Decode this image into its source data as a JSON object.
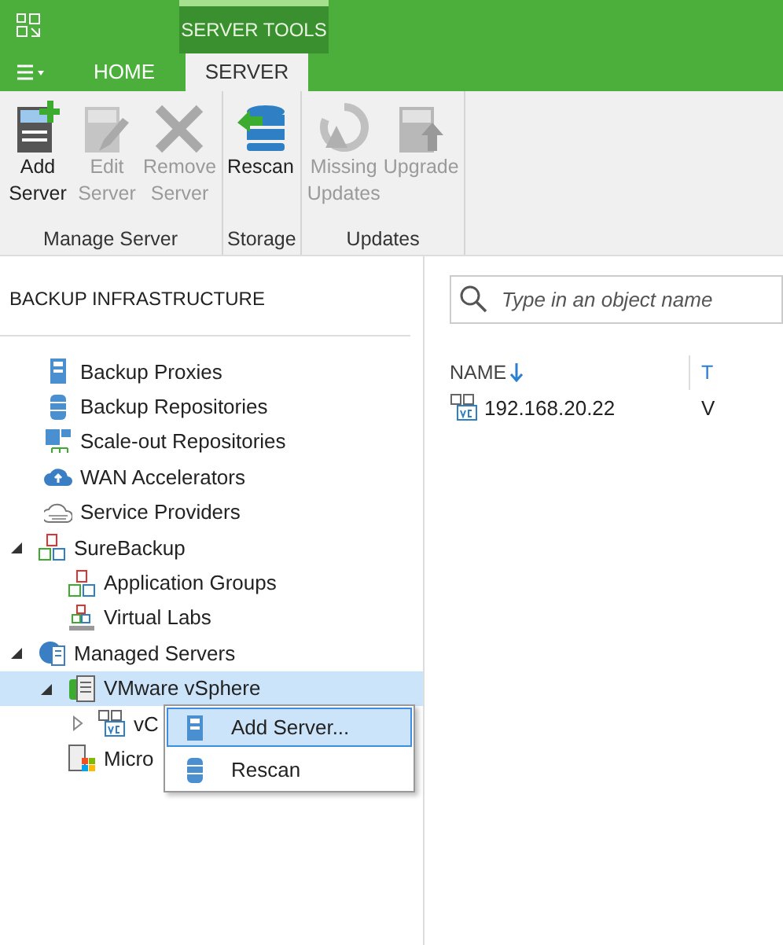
{
  "title_bar": {
    "context_tab": "SERVER TOOLS"
  },
  "tabs": [
    {
      "label": "HOME",
      "selected": false
    },
    {
      "label": "SERVER",
      "selected": true
    }
  ],
  "ribbon": {
    "groups": [
      {
        "label": "Manage Server",
        "buttons": [
          {
            "kind": "add-server",
            "label": "Add Server",
            "disabled": false
          },
          {
            "kind": "edit-server",
            "label": "Edit Server",
            "disabled": true
          },
          {
            "kind": "remove",
            "label": "Remove Server",
            "disabled": true
          }
        ]
      },
      {
        "label": "Storage",
        "buttons": [
          {
            "kind": "rescan",
            "label": "Rescan",
            "disabled": false
          }
        ]
      },
      {
        "label": "Updates",
        "buttons": [
          {
            "kind": "missing-updates",
            "label": "Missing Updates",
            "disabled": true
          },
          {
            "kind": "upgrade",
            "label": "Upgrade",
            "disabled": true
          }
        ]
      }
    ]
  },
  "sidebar": {
    "title": "BACKUP INFRASTRUCTURE",
    "items": [
      {
        "kind": "proxy",
        "label": "Backup Proxies",
        "selected": false
      },
      {
        "kind": "repository",
        "label": "Backup Repositories",
        "selected": false
      },
      {
        "kind": "scaleout",
        "label": "Scale-out Repositories",
        "selected": false
      },
      {
        "kind": "wan",
        "label": "WAN Accelerators",
        "selected": false
      },
      {
        "kind": "provider",
        "label": "Service Providers",
        "selected": false
      },
      {
        "kind": "surebackup",
        "label": "SureBackup",
        "selected": false,
        "expanded": true,
        "children": [
          {
            "kind": "surebackup",
            "label": "Application Groups",
            "selected": false
          },
          {
            "kind": "lab",
            "label": "Virtual Labs",
            "selected": false
          }
        ]
      },
      {
        "kind": "managed",
        "label": "Managed Servers",
        "selected": false,
        "expanded": true,
        "children": [
          {
            "kind": "vsphere",
            "label": "VMware vSphere",
            "selected": true,
            "expanded": true,
            "children": [
              {
                "kind": "vc",
                "label": "vC",
                "selected": false,
                "expanded": false
              }
            ]
          },
          {
            "kind": "windows",
            "label": "Micro",
            "selected": false
          }
        ]
      }
    ]
  },
  "search": {
    "placeholder": "Type in an object name"
  },
  "table": {
    "columns": [
      {
        "label": "NAME",
        "sorted": true
      },
      {
        "label": "T",
        "sorted": false
      }
    ],
    "rows": [
      {
        "cells": [
          "192.168.20.22",
          "V"
        ]
      }
    ]
  },
  "context_menu": {
    "items": [
      {
        "kind": "add-server",
        "label": "Add Server...",
        "selected": true
      },
      {
        "kind": "rescan",
        "label": "Rescan",
        "selected": false
      }
    ]
  }
}
